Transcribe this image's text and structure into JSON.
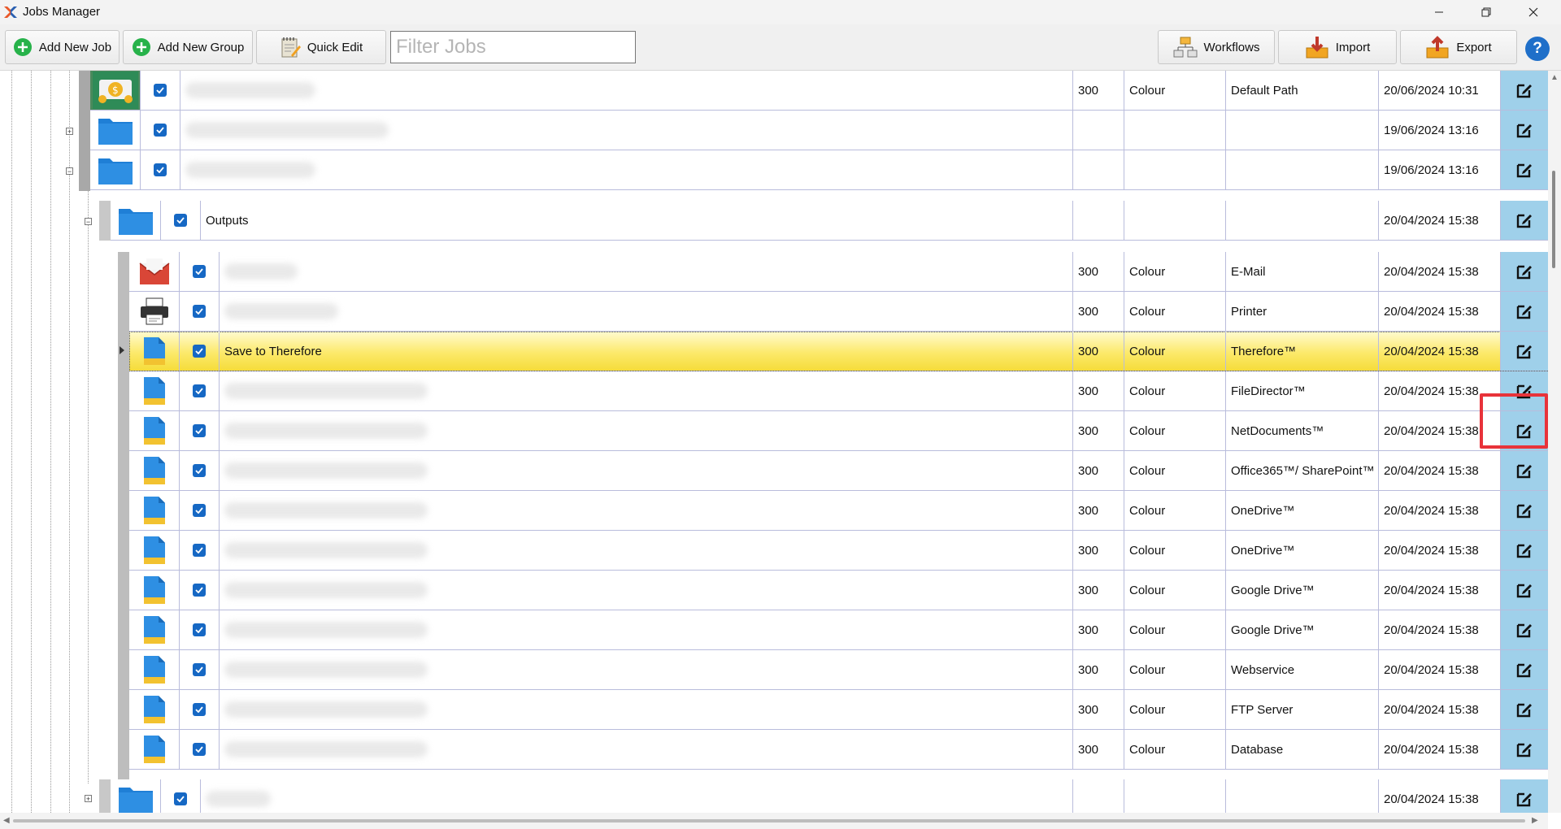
{
  "window": {
    "title": "Jobs Manager"
  },
  "toolbar": {
    "add_job": "Add New Job",
    "add_group": "Add New Group",
    "quick_edit": "Quick Edit",
    "filter_placeholder": "Filter Jobs",
    "workflows": "Workflows",
    "import": "Import",
    "export": "Export",
    "help": "?"
  },
  "colors": {
    "accent": "#1668c4",
    "edit_column": "#9fd0ea",
    "selected_row": "#fce96a",
    "highlight_box": "#e8333a"
  },
  "rows": [
    {
      "icon": "money-icon",
      "name": "",
      "dpi": "300",
      "mode": "Colour",
      "destination": "Default Path",
      "date": "20/06/2024 10:31"
    },
    {
      "icon": "folder-icon",
      "name": "",
      "dpi": "",
      "mode": "",
      "destination": "",
      "date": "19/06/2024 13:16"
    },
    {
      "icon": "folder-icon",
      "name": "",
      "dpi": "",
      "mode": "",
      "destination": "",
      "date": "19/06/2024 13:16"
    },
    {
      "icon": "folder-icon",
      "name": "Outputs",
      "dpi": "",
      "mode": "",
      "destination": "",
      "date": "20/04/2024 15:38"
    },
    {
      "icon": "email-icon",
      "name": "",
      "dpi": "300",
      "mode": "Colour",
      "destination": "E-Mail",
      "date": "20/04/2024 15:38"
    },
    {
      "icon": "printer-icon",
      "name": "",
      "dpi": "300",
      "mode": "Colour",
      "destination": "Printer",
      "date": "20/04/2024 15:38"
    },
    {
      "icon": "document-icon",
      "name": "Save to Therefore",
      "dpi": "300",
      "mode": "Colour",
      "destination": "Therefore™",
      "date": "20/04/2024 15:38"
    },
    {
      "icon": "document-icon",
      "name": "",
      "dpi": "300",
      "mode": "Colour",
      "destination": "FileDirector™",
      "date": "20/04/2024 15:38"
    },
    {
      "icon": "document-icon",
      "name": "",
      "dpi": "300",
      "mode": "Colour",
      "destination": "NetDocuments™",
      "date": "20/04/2024 15:38"
    },
    {
      "icon": "document-icon",
      "name": "",
      "dpi": "300",
      "mode": "Colour",
      "destination": "Office365™/ SharePoint™",
      "date": "20/04/2024 15:38"
    },
    {
      "icon": "document-icon",
      "name": "",
      "dpi": "300",
      "mode": "Colour",
      "destination": "OneDrive™",
      "date": "20/04/2024 15:38"
    },
    {
      "icon": "document-icon",
      "name": "",
      "dpi": "300",
      "mode": "Colour",
      "destination": "OneDrive™",
      "date": "20/04/2024 15:38"
    },
    {
      "icon": "document-icon",
      "name": "",
      "dpi": "300",
      "mode": "Colour",
      "destination": "Google Drive™",
      "date": "20/04/2024 15:38"
    },
    {
      "icon": "document-icon",
      "name": "",
      "dpi": "300",
      "mode": "Colour",
      "destination": "Google Drive™",
      "date": "20/04/2024 15:38"
    },
    {
      "icon": "document-icon",
      "name": "",
      "dpi": "300",
      "mode": "Colour",
      "destination": "Webservice",
      "date": "20/04/2024 15:38"
    },
    {
      "icon": "document-icon",
      "name": "",
      "dpi": "300",
      "mode": "Colour",
      "destination": "FTP Server",
      "date": "20/04/2024 15:38"
    },
    {
      "icon": "document-icon",
      "name": "",
      "dpi": "300",
      "mode": "Colour",
      "destination": "Database",
      "date": "20/04/2024 15:38"
    },
    {
      "icon": "folder-icon",
      "name": "",
      "dpi": "",
      "mode": "",
      "destination": "",
      "date": "20/04/2024 15:38"
    }
  ]
}
